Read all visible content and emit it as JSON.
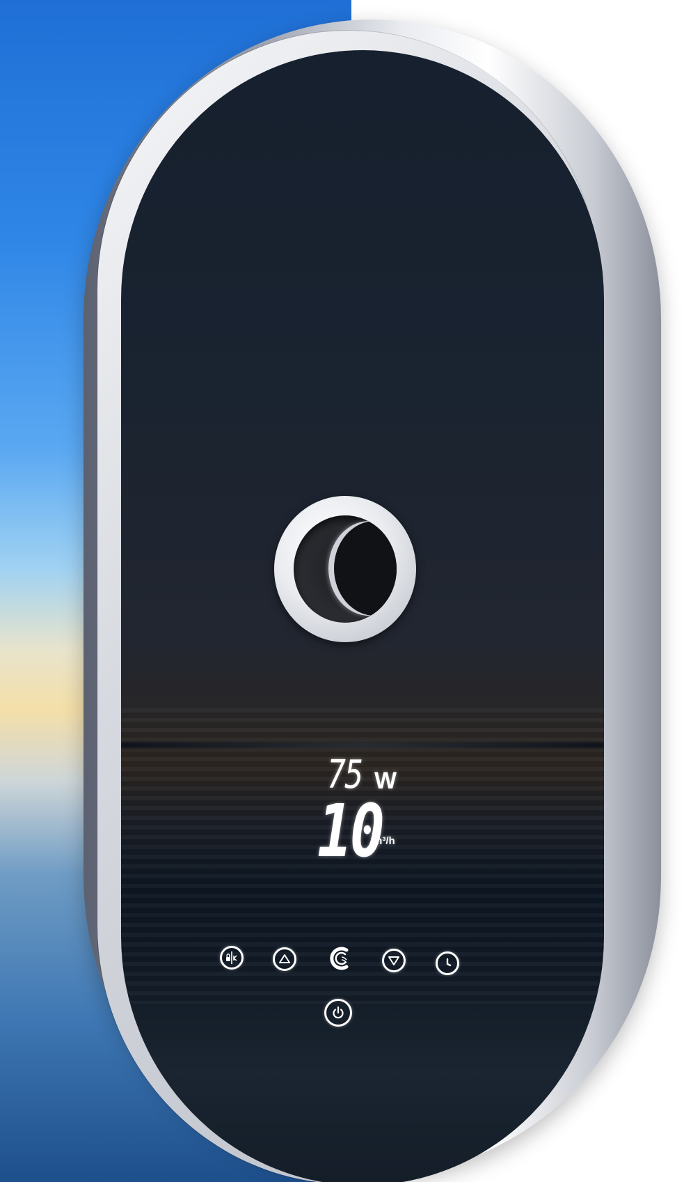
{
  "display": {
    "power_value": "75",
    "power_unit": "W",
    "flow_value": "10",
    "flow_unit": "m³/h"
  },
  "controls": {
    "buttons": [
      {
        "icon": "lock-icon",
        "name": "child-lock-button"
      },
      {
        "icon": "triangle-up-icon",
        "name": "increase-button"
      },
      {
        "icon": "brand-logo-icon",
        "name": "mode-logo-button"
      },
      {
        "icon": "triangle-down-icon",
        "name": "decrease-button"
      },
      {
        "icon": "clock-icon",
        "name": "timer-button"
      },
      {
        "icon": "power-icon",
        "name": "power-button"
      }
    ]
  },
  "colors": {
    "panel": "#1a2330",
    "shell": "#e9ebf0",
    "led": "#ffffff",
    "sky": "#2f86e6"
  }
}
